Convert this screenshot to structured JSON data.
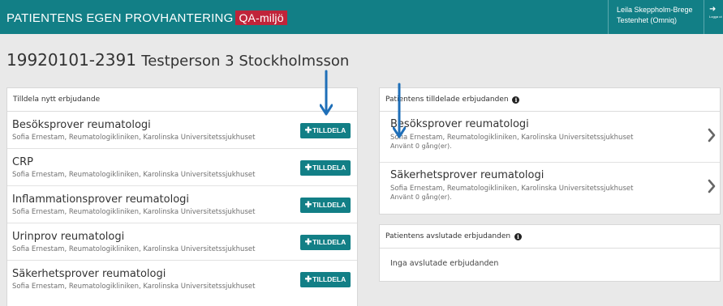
{
  "header": {
    "app_title": "PATIENTENS EGEN PROVHANTERING",
    "env_badge": "QA-miljö",
    "user_name": "Leila Skeppholm-Brege",
    "user_unit": "Testenhet (Omniq)",
    "logout_label": "Logga ut",
    "brand_color": "#127f86",
    "env_color": "#c0243a"
  },
  "patient": {
    "id": "19920101-2391",
    "name": "Testperson 3 Stockholmsson"
  },
  "assign_panel": {
    "title": "Tilldela nytt erbjudande",
    "button_label": "TILLDELA",
    "offers": [
      {
        "name": "Besöksprover reumatologi",
        "sub": "Sofia Ernestam, Reumatologikliniken, Karolinska Universitetssjukhuset"
      },
      {
        "name": "CRP",
        "sub": "Sofia Ernestam, Reumatologikliniken, Karolinska Universitetssjukhuset"
      },
      {
        "name": "Inflammationsprover reumatologi",
        "sub": "Sofia Ernestam, Reumatologikliniken, Karolinska Universitetssjukhuset"
      },
      {
        "name": "Urinprov reumatologi",
        "sub": "Sofia Ernestam, Reumatologikliniken, Karolinska Universitetssjukhuset"
      },
      {
        "name": "Säkerhetsprover reumatologi",
        "sub": "Sofia Ernestam, Reumatologikliniken, Karolinska Universitetssjukhuset"
      }
    ]
  },
  "assigned_panel": {
    "title": "Patientens tilldelade erbjudanden",
    "items": [
      {
        "name": "Besöksprover reumatologi",
        "sub": "Sofia Ernestam, Reumatologikliniken, Karolinska Universitetssjukhuset",
        "used": "Använt 0 gång(er)."
      },
      {
        "name": "Säkerhetsprover reumatologi",
        "sub": "Sofia Ernestam, Reumatologikliniken, Karolinska Universitetssjukhuset",
        "used": "Använt 0 gång(er)."
      }
    ]
  },
  "finished_panel": {
    "title": "Patientens avslutade erbjudanden",
    "empty_text": "Inga avslutade erbjudanden"
  },
  "annotation_color": "#1f6fb8"
}
